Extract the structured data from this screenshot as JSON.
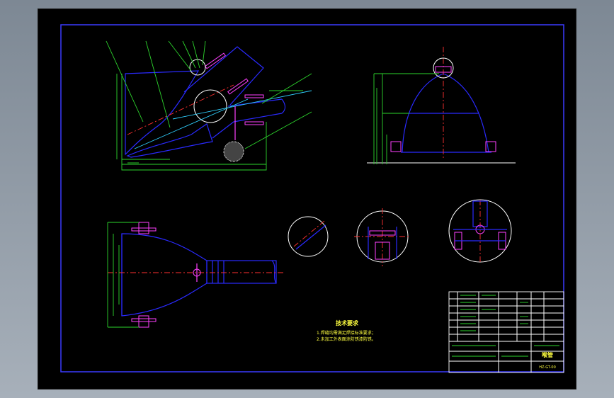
{
  "tech_requirements": {
    "title": "技术要求",
    "lines": [
      "1.焊缝均需满足焊接标准要求；",
      "2.未加工外表面涂防锈漆防锈。"
    ]
  },
  "title_block": {
    "drawing_name": "喉管",
    "drawing_number": "HZ-GT-00"
  },
  "colors": {
    "outline": "#2a2aff",
    "dimension": "#2dd62d",
    "centerline": "#ff3030",
    "text": "#ffff40",
    "sheet_background": "#000000",
    "window_background": "#8a949e"
  }
}
